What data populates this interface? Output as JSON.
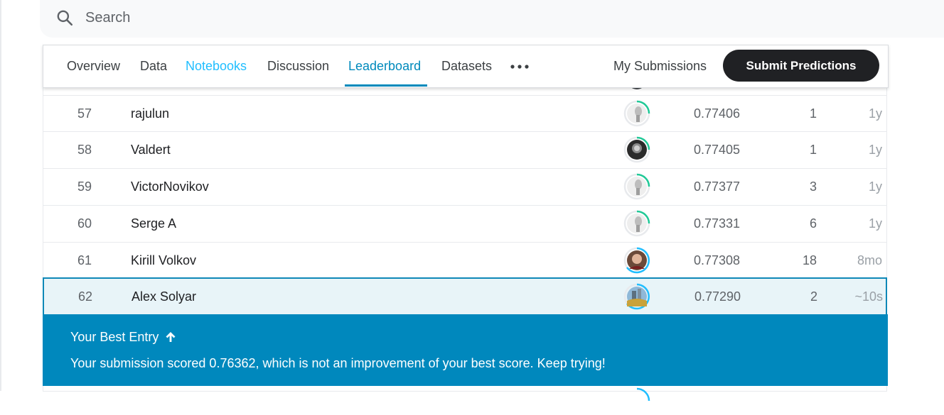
{
  "search": {
    "placeholder": "Search"
  },
  "tabs": [
    {
      "label": "Overview"
    },
    {
      "label": "Data"
    },
    {
      "label": "Notebooks"
    },
    {
      "label": "Discussion"
    },
    {
      "label": "Leaderboard"
    },
    {
      "label": "Datasets"
    }
  ],
  "more_icon": "more-horizontal-icon",
  "my_submissions_label": "My Submissions",
  "submit_label": "Submit Predictions",
  "leaderboard": {
    "rows": [
      {
        "rank": "57",
        "team": "rajulun",
        "score": "0.77406",
        "entries": "1",
        "last": "1y"
      },
      {
        "rank": "58",
        "team": "Valdert",
        "score": "0.77405",
        "entries": "1",
        "last": "1y"
      },
      {
        "rank": "59",
        "team": "VictorNovikov",
        "score": "0.77377",
        "entries": "3",
        "last": "1y"
      },
      {
        "rank": "60",
        "team": "Serge A",
        "score": "0.77331",
        "entries": "6",
        "last": "1y"
      },
      {
        "rank": "61",
        "team": "Kirill Volkov",
        "score": "0.77308",
        "entries": "18",
        "last": "8mo"
      },
      {
        "rank": "62",
        "team": "Alex Solyar",
        "score": "0.77290",
        "entries": "2",
        "last": "~10s"
      }
    ]
  },
  "banner": {
    "title": "Your Best Entry",
    "message": "Your submission scored 0.76362, which is not an improvement of your best score. Keep trying!"
  },
  "colors": {
    "accent": "#008abc",
    "banner": "#0088bd",
    "tier_ring_green": "#20c997",
    "tier_ring_blue": "#20beff"
  }
}
